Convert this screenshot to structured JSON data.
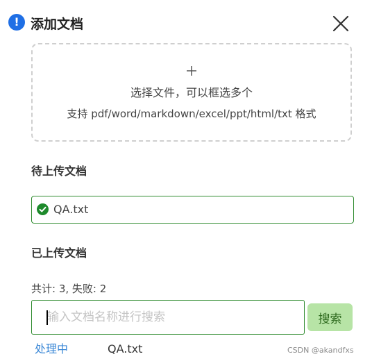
{
  "dialog": {
    "title": "添加文档",
    "info_icon_glyph": "!",
    "close_icon": "close-icon"
  },
  "dropzone": {
    "plus_icon": "plus-icon",
    "line1": "选择文件，可以框选多个",
    "line2": "支持 pdf/word/markdown/excel/ppt/html/txt 格式"
  },
  "pending": {
    "label": "待上传文档",
    "items": [
      {
        "name": "QA.txt",
        "status_icon": "check-circle-icon"
      }
    ]
  },
  "uploaded": {
    "label": "已上传文档",
    "stats": "共计: 3, 失败: 2",
    "search": {
      "placeholder": "输入文档名称进行搜索",
      "value": "",
      "button_label": "搜索"
    },
    "rows": [
      {
        "status": "处理中",
        "name": "QA.txt"
      }
    ]
  },
  "watermark": "CSDN @akandfxs",
  "colors": {
    "accent_blue": "#1f6fe5",
    "success_green": "#1e8a2c",
    "search_button_bg": "#b7e4a6",
    "processing_text": "#3a87d6"
  }
}
